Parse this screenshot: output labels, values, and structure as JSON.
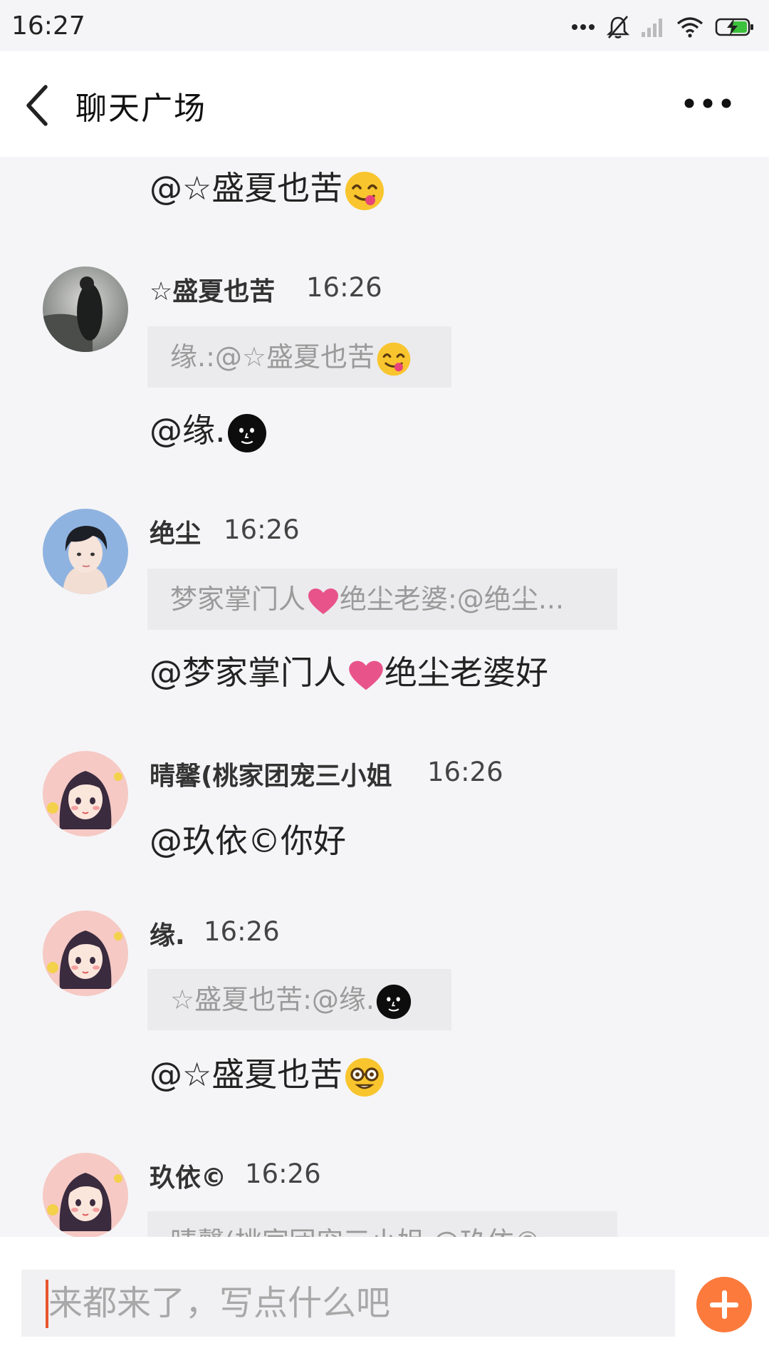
{
  "status_bar": {
    "time": "16:27",
    "icons": [
      "more-dots-icon",
      "bell-muted-icon",
      "signal-icon",
      "wifi-icon",
      "battery-charging-icon"
    ]
  },
  "header": {
    "title": "聊天广场",
    "back_icon": "chevron-left-icon",
    "more_icon": "more-horizontal-icon"
  },
  "messages": [
    {
      "text": "@☆盛夏也苦",
      "emoji": "yum-face-emoji"
    },
    {
      "sender": "☆盛夏也苦",
      "time": "16:26",
      "quote": "缘.:@☆盛夏也苦",
      "quote_emoji": "yum-face-emoji",
      "text": "@缘.",
      "emoji": "new-moon-face-emoji"
    },
    {
      "sender": "绝尘",
      "time": "16:26",
      "quote_parts": [
        "梦家掌门人",
        "绝尘老婆:@绝尘..."
      ],
      "text_parts": [
        "@梦家掌门人",
        "绝尘老婆好"
      ],
      "heart_icon": "pink-heart-emoji"
    },
    {
      "sender": "晴馨(桃家团宠三小姐",
      "time": "16:26",
      "text": "@玖依©你好"
    },
    {
      "sender": "缘.",
      "time": "16:26",
      "quote": "☆盛夏也苦:@缘.",
      "quote_emoji": "new-moon-face-emoji",
      "text": "@☆盛夏也苦",
      "emoji": "nerd-face-emoji"
    },
    {
      "sender": "玖依©",
      "time": "16:26",
      "quote": "晴馨(桃家团宠三小姐 @玖依©"
    }
  ],
  "input": {
    "placeholder": "来都来了，写点什么吧",
    "add_icon": "plus-circle-icon"
  },
  "colors": {
    "accent": "#fb7a3c",
    "caret": "#e8552d",
    "background": "#f5f5f7",
    "quote_bg": "#ebebed",
    "heart": "#e8548a"
  }
}
